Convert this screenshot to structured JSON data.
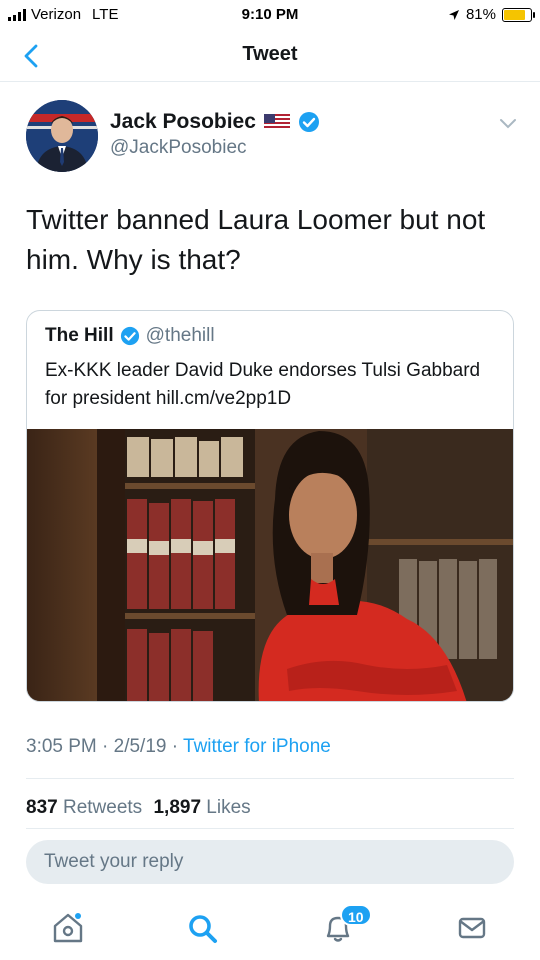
{
  "status_bar": {
    "carrier": "Verizon",
    "network": "LTE",
    "time": "9:10 PM",
    "battery": "81%",
    "battery_level": 0.81
  },
  "nav": {
    "title": "Tweet"
  },
  "tweet": {
    "author_name": "Jack Posobiec",
    "author_handle": "@JackPosobiec",
    "text": "Twitter banned Laura Loomer but not him. Why is that?",
    "timestamp": "3:05 PM · 2/5/19 · ",
    "source": "Twitter for iPhone",
    "retweets_count": "837",
    "retweets_label": "Retweets",
    "likes_count": "1,897",
    "likes_label": "Likes"
  },
  "quoted_tweet": {
    "author_name": "The Hill",
    "author_handle": "@thehill",
    "text": "Ex-KKK leader David Duke endorses Tulsi Gabbard for president hill.cm/ve2pp1D"
  },
  "reply": {
    "placeholder": "Tweet your reply"
  },
  "tab_bar": {
    "notifications_badge": "10",
    "icons": [
      "home-icon",
      "search-icon",
      "notifications-icon",
      "messages-icon"
    ]
  },
  "colors": {
    "accent": "#1da1f2",
    "secondary_text": "#657786",
    "divider": "#e6ecf0",
    "battery": "#f5c400"
  }
}
